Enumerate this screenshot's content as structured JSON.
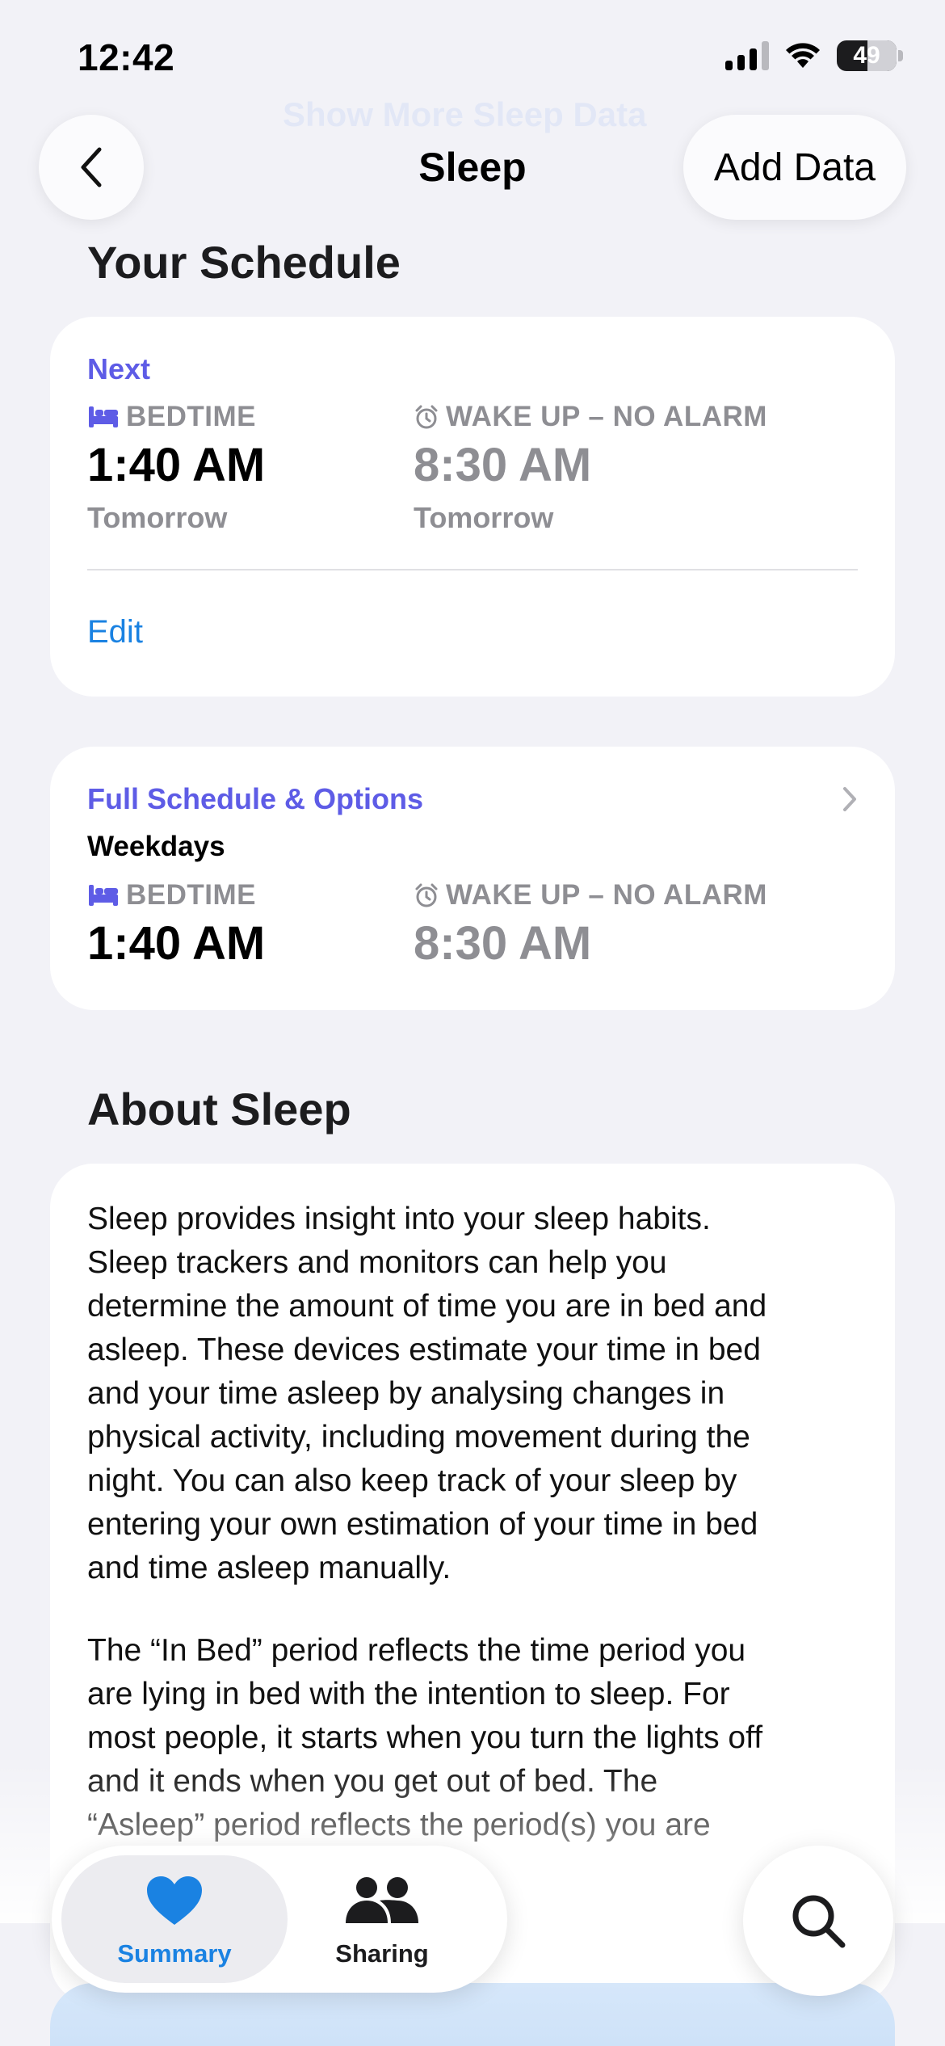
{
  "status_bar": {
    "time": "12:42",
    "battery": "49"
  },
  "background_hint": "Show More Sleep Data",
  "nav": {
    "title": "Sleep",
    "add_data": "Add Data"
  },
  "schedule": {
    "section_title": "Your Schedule",
    "next_label": "Next",
    "bedtime_label": "BEDTIME",
    "bedtime_value": "1:40 AM",
    "bedtime_day": "Tomorrow",
    "wake_label": "WAKE UP – NO ALARM",
    "wake_value": "8:30 AM",
    "wake_day": "Tomorrow",
    "edit": "Edit"
  },
  "full_schedule": {
    "title": "Full Schedule & Options",
    "days": "Weekdays",
    "bedtime_label": "BEDTIME",
    "bedtime_value": "1:40 AM",
    "wake_label": "WAKE UP – NO ALARM",
    "wake_value": "8:30 AM"
  },
  "about": {
    "section_title": "About Sleep",
    "paragraph1_lines": [
      "Sleep provides insight into your sleep habits.",
      "Sleep trackers and monitors can help you",
      "determine the amount of time you are in bed and",
      "asleep. These devices estimate your time in bed",
      "and your time asleep by analysing changes in",
      "physical activity, including movement during the",
      "night. You can also keep track of your sleep by",
      "entering your own estimation of your time in bed",
      "and time asleep manually."
    ],
    "paragraph2_lines": [
      "The “In Bed” period reflects the time period you",
      "are lying in bed with the intention to sleep. For",
      "most people, it starts when you turn the lights off",
      "and it ends when you get out of bed. The",
      "“Asleep” period reflects the period(s) you are"
    ]
  },
  "tabs": {
    "summary": "Summary",
    "sharing": "Sharing"
  },
  "colors": {
    "accent_purple": "#5e5ce6",
    "link_blue": "#1a82e2",
    "tab_blue": "#1a82e2",
    "gray": "#8e8e93"
  }
}
